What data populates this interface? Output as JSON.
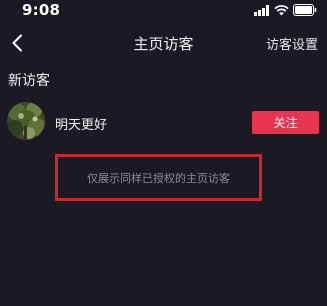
{
  "status_bar": {
    "time": "9:08",
    "icons": [
      "signal-bars-icon",
      "wifi-icon",
      "battery-icon"
    ]
  },
  "nav": {
    "back_icon": "chevron-left-icon",
    "title": "主页访客",
    "settings_label": "访客设置"
  },
  "section": {
    "title": "新访客"
  },
  "visitors": [
    {
      "name": "明天更好",
      "follow_label": "关注"
    }
  ],
  "notice": {
    "text": "仅展示同样已授权的主页访客"
  },
  "colors": {
    "background": "#1b1a24",
    "follow_button": "#e9344f",
    "highlight_border": "#e01f25",
    "notice_text": "#8d8b96"
  }
}
